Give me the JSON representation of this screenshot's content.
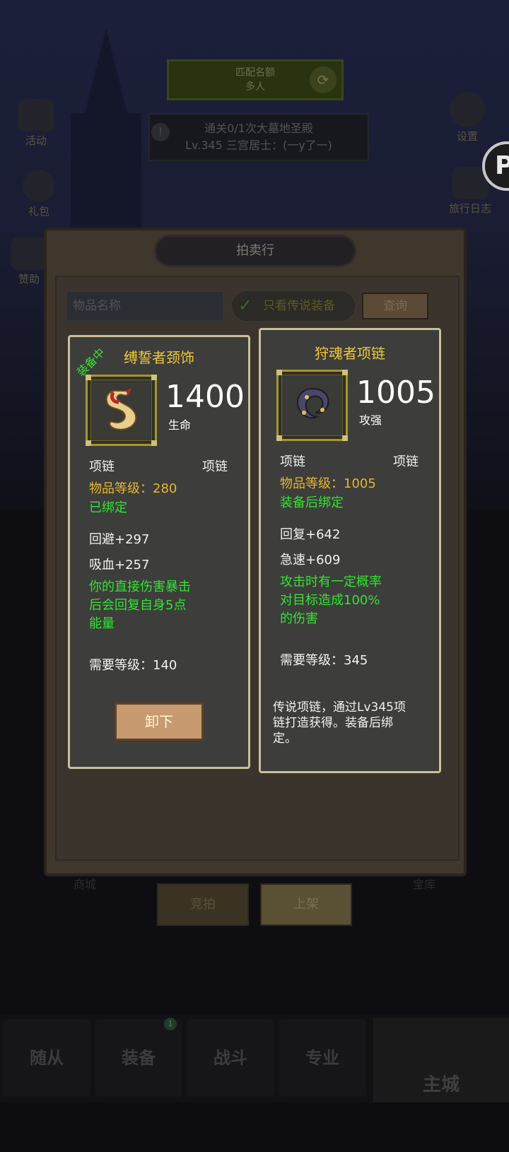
{
  "background": {
    "top_banner": [
      "匹配名额",
      "多人"
    ],
    "quest": {
      "line1": "通关0/1次大墓地圣殿",
      "line2": "Lv.345 三宫居士：(一y了一)"
    },
    "left_icons": [
      {
        "label": "活动",
        "icon": "event-icon"
      },
      {
        "label": "礼包",
        "icon": "gift-icon"
      },
      {
        "label": "赞助",
        "icon": "sponsor-icon"
      }
    ],
    "right_icons": [
      {
        "label": "设置",
        "icon": "gear-icon"
      },
      {
        "label": "旅行日志",
        "icon": "journal-icon"
      }
    ],
    "badge_letter": "P",
    "grid_labels": [
      "商城",
      "宝库"
    ]
  },
  "bottom_nav": {
    "tabs": [
      "随从",
      "装备",
      "战斗",
      "专业"
    ],
    "main": "主城",
    "badge": "1"
  },
  "auction": {
    "title": "拍卖行",
    "search_placeholder": "物品名称",
    "legendary_toggle": "只看传说装备",
    "query_button": "查询",
    "bottom_buttons": [
      "竞拍",
      "上架"
    ]
  },
  "equipped_item": {
    "badge": "装备中",
    "name": "缚誓者颈饰",
    "stat_value": "1400",
    "stat_label": "生命",
    "type_left": "项链",
    "type_right": "项链",
    "item_level": "物品等级：280",
    "bind_status": "已绑定",
    "attributes": [
      "回避+297",
      "吸血+257"
    ],
    "effect_lines": [
      "你的直接伤害暴击",
      "后会回复自身5点",
      "能量"
    ],
    "required_level": "需要等级：140",
    "action_button": "卸下"
  },
  "compare_item": {
    "name": "狩魂者项链",
    "stat_value": "1005",
    "stat_label": "攻强",
    "type_left": "项链",
    "type_right": "项链",
    "item_level": "物品等级：1005",
    "bind_status": "装备后绑定",
    "attributes": [
      "回复+642",
      "急速+609"
    ],
    "effect_lines": [
      "攻击时有一定概率",
      "对目标造成100%",
      "的伤害"
    ],
    "required_level": "需要等级：345",
    "description_lines": [
      "传说项链，通过Lv345项",
      "链打造获得。装备后绑",
      "定。"
    ]
  },
  "colors": {
    "title_gold": "#f0c83a",
    "level_gold": "#e7b530",
    "effect_green": "#31e431",
    "card_border": "#c9bf9c"
  }
}
